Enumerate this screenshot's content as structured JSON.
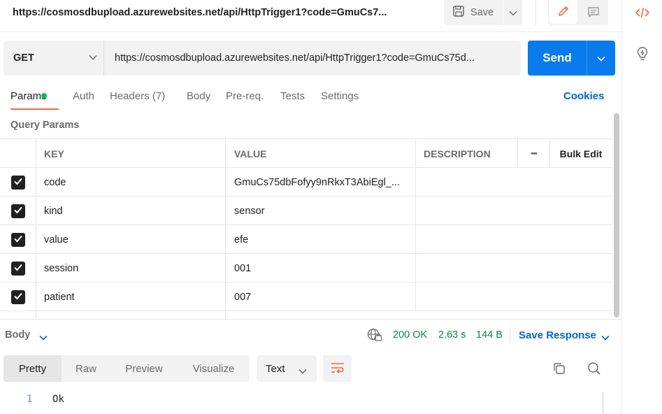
{
  "header": {
    "title": "https://cosmosdbupload.azurewebsites.net/api/HttpTrigger1?code=GmuCs7...",
    "save_label": "Save"
  },
  "request": {
    "method": "GET",
    "url": "https://cosmosdbupload.azurewebsites.net/api/HttpTrigger1?code=GmuCs75d...",
    "send_label": "Send"
  },
  "tabs": [
    {
      "label": "Params",
      "active": true,
      "has_indicator": true
    },
    {
      "label": "Auth"
    },
    {
      "label": "Headers (7)"
    },
    {
      "label": "Body"
    },
    {
      "label": "Pre-req."
    },
    {
      "label": "Tests"
    },
    {
      "label": "Settings"
    }
  ],
  "cookies_label": "Cookies",
  "query_params": {
    "title": "Query Params",
    "headers": {
      "key": "KEY",
      "value": "VALUE",
      "description": "DESCRIPTION",
      "more": "•••",
      "bulk_edit": "Bulk Edit"
    },
    "rows": [
      {
        "checked": true,
        "key": "code",
        "value": "GmuCs75dbFofyy9nRkxT3AbiEgl_...",
        "description": ""
      },
      {
        "checked": true,
        "key": "kind",
        "value": "sensor",
        "description": ""
      },
      {
        "checked": true,
        "key": "value",
        "value": "efe",
        "description": ""
      },
      {
        "checked": true,
        "key": "session",
        "value": "001",
        "description": ""
      },
      {
        "checked": true,
        "key": "patient",
        "value": "007",
        "description": ""
      }
    ]
  },
  "response": {
    "body_label": "Body",
    "status": "200 OK",
    "time": "2.63 s",
    "size": "144 B",
    "save_response_label": "Save Response",
    "view_tabs": [
      "Pretty",
      "Raw",
      "Preview",
      "Visualize"
    ],
    "format": "Text",
    "lines": [
      {
        "num": "1",
        "text": "Ok"
      }
    ]
  },
  "colors": {
    "accent": "#097bed",
    "tab_underline": "#f26b3a",
    "status_ok": "#0a8a3e",
    "link": "#0265d2",
    "indicator": "#0cbb52"
  }
}
